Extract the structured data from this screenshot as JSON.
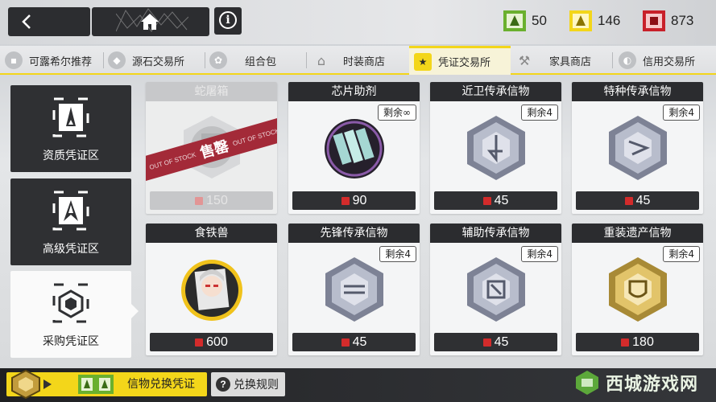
{
  "topbar": {
    "currencies": [
      {
        "name": "green-voucher",
        "value": "50",
        "color": "#6ab02e"
      },
      {
        "name": "yellow-voucher",
        "value": "146",
        "color": "#f3d61a"
      },
      {
        "name": "red-voucher",
        "value": "873",
        "color": "#c8202a"
      }
    ]
  },
  "tabs": [
    {
      "label": "可露希尔推荐",
      "icon": "bag-icon"
    },
    {
      "label": "源石交易所",
      "icon": "originite-icon"
    },
    {
      "label": "组合包",
      "icon": "bundle-icon"
    },
    {
      "label": "时装商店",
      "icon": "hanger-icon"
    },
    {
      "label": "凭证交易所",
      "icon": "voucher-icon",
      "active": true
    },
    {
      "label": "家具商店",
      "icon": "hammer-icon"
    },
    {
      "label": "信用交易所",
      "icon": "credit-icon"
    }
  ],
  "side": [
    {
      "label": "资质凭证区"
    },
    {
      "label": "高级凭证区"
    },
    {
      "label": "采购凭证区",
      "active": true
    }
  ],
  "cards": [
    {
      "name": "蛇屠箱",
      "price": "150",
      "soldout": true,
      "sold_cn": "售罄",
      "sold_en": "OUT OF STOCK"
    },
    {
      "name": "芯片助剂",
      "stock": "剩余∞",
      "price": "90"
    },
    {
      "name": "近卫传承信物",
      "stock": "剩余4",
      "price": "45"
    },
    {
      "name": "特种传承信物",
      "stock": "剩余4",
      "price": "45"
    },
    {
      "name": "食铁兽",
      "price": "600"
    },
    {
      "name": "先锋传承信物",
      "stock": "剩余4",
      "price": "45"
    },
    {
      "name": "辅助传承信物",
      "stock": "剩余4",
      "price": "45"
    },
    {
      "name": "重装遗产信物",
      "stock": "剩余4",
      "price": "180"
    }
  ],
  "bottombar": {
    "exchange_label": "信物兑换凭证",
    "rules_label": "兑换规则"
  },
  "watermark": "西城游戏网"
}
